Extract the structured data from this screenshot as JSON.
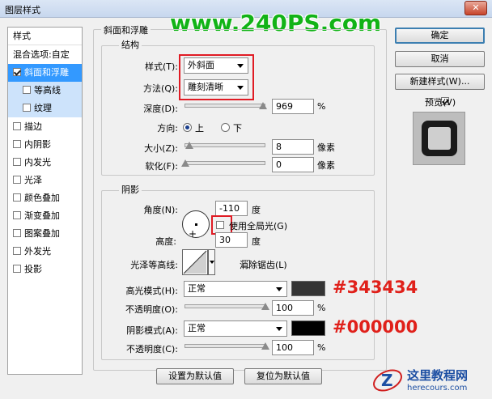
{
  "window": {
    "title": "图层样式",
    "close": "✕"
  },
  "watermark": "www.240PS.com",
  "sidebar": {
    "header": "样式",
    "blend_options": "混合选项:自定",
    "items": [
      {
        "label": "斜面和浮雕",
        "checked": true
      },
      {
        "label": "等高线",
        "checked": false
      },
      {
        "label": "纹理",
        "checked": false
      },
      {
        "label": "描边",
        "checked": false
      },
      {
        "label": "内阴影",
        "checked": false
      },
      {
        "label": "内发光",
        "checked": false
      },
      {
        "label": "光泽",
        "checked": false
      },
      {
        "label": "颜色叠加",
        "checked": false
      },
      {
        "label": "渐变叠加",
        "checked": false
      },
      {
        "label": "图案叠加",
        "checked": false
      },
      {
        "label": "外发光",
        "checked": false
      },
      {
        "label": "投影",
        "checked": false
      }
    ]
  },
  "bevel": {
    "title": "斜面和浮雕",
    "structure_title": "结构",
    "style_label": "样式(T):",
    "style_value": "外斜面",
    "technique_label": "方法(Q):",
    "technique_value": "雕刻清晰",
    "depth_label": "深度(D):",
    "depth_value": "969",
    "depth_unit": "%",
    "depth_level": 0.97,
    "direction_label": "方向:",
    "direction_up": "上",
    "direction_down": "下",
    "size_label": "大小(Z):",
    "size_value": "8",
    "size_unit": "像素",
    "soften_label": "软化(F):",
    "soften_value": "0",
    "soften_unit": "像素"
  },
  "shading": {
    "title": "阴影",
    "angle_label": "角度(N):",
    "angle_value": "-110",
    "angle_unit": "度",
    "global_light_label": "使用全局光(G)",
    "altitude_label": "高度:",
    "altitude_value": "30",
    "altitude_unit": "度",
    "gloss_label": "光泽等高线:",
    "antialias_label": "消除锯齿(L)",
    "highlight_label": "高光模式(H):",
    "highlight_mode": "正常",
    "highlight_color": "#343434",
    "highlight_color_label": "#343434",
    "highlight_opacity_label": "不透明度(O):",
    "highlight_opacity": "100",
    "highlight_opacity_unit": "%",
    "shadow_label": "阴影模式(A):",
    "shadow_mode": "正常",
    "shadow_color": "#000000",
    "shadow_color_label": "#000000",
    "shadow_opacity_label": "不透明度(C):",
    "shadow_opacity": "100",
    "shadow_opacity_unit": "%"
  },
  "buttons": {
    "ok": "确定",
    "cancel": "取消",
    "new_style": "新建样式(W)...",
    "preview": "预览(V)",
    "make_default": "设置为默认值",
    "reset_default": "复位为默认值"
  },
  "logo": {
    "name": "这里教程网",
    "url": "herecours.com"
  },
  "colors": {
    "accent": "#3399ff",
    "highlight_red": "#e0201a",
    "watermark_green": "#12b317"
  }
}
